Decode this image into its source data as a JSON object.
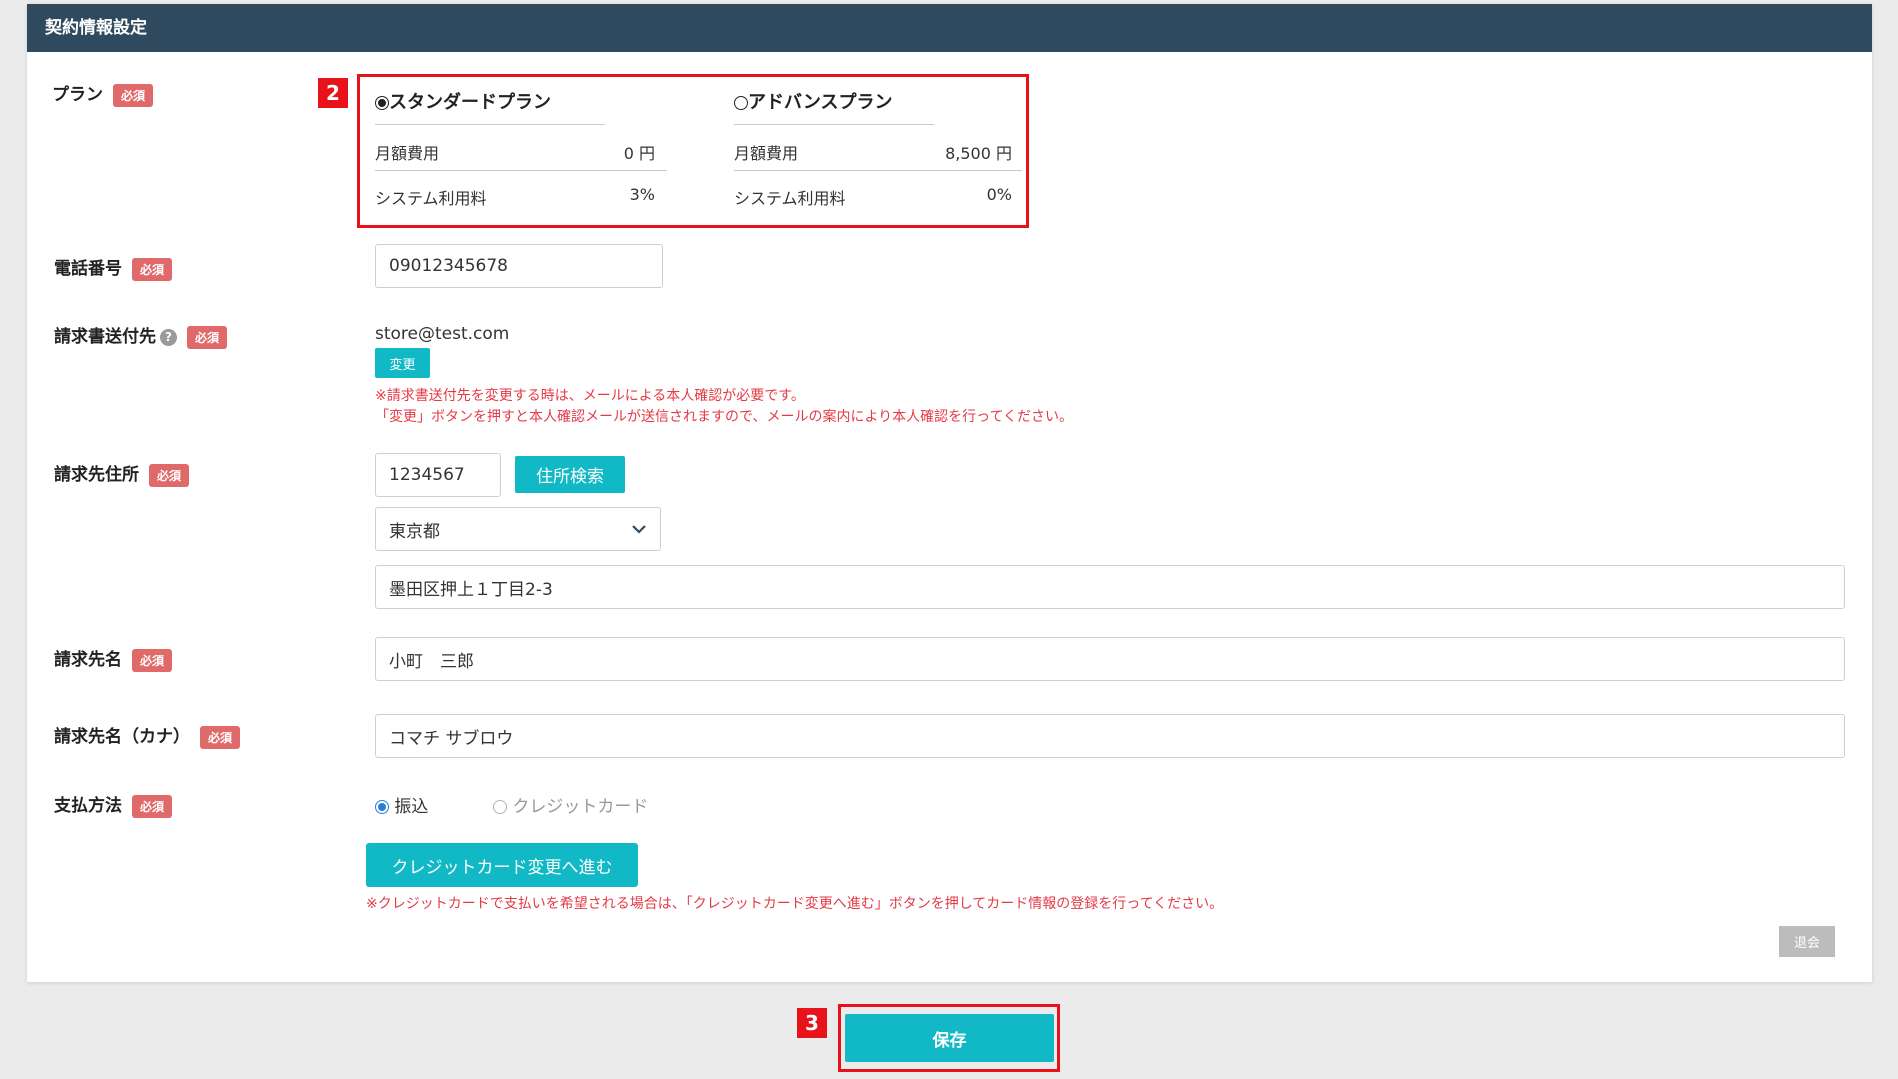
{
  "header": {
    "title": "契約情報設定"
  },
  "required_badge": "必須",
  "markers": {
    "plan": "2",
    "save": "3"
  },
  "plan": {
    "label": "プラン",
    "options": [
      {
        "name": "スタンダードプラン",
        "selected": true,
        "rows": [
          {
            "key": "月額費用",
            "value": "0 円"
          },
          {
            "key": "システム利用料",
            "value": "3%"
          }
        ]
      },
      {
        "name": "アドバンスプラン",
        "selected": false,
        "rows": [
          {
            "key": "月額費用",
            "value": "8,500 円"
          },
          {
            "key": "システム利用料",
            "value": "0%"
          }
        ]
      }
    ]
  },
  "phone": {
    "label": "電話番号",
    "value": "09012345678"
  },
  "invoice_email": {
    "label": "請求書送付先",
    "help_icon": "question-icon",
    "value": "store@test.com",
    "change_button": "変更",
    "note_line1": "※請求書送付先を変更する時は、メールによる本人確認が必要です。",
    "note_line2": "「変更」ボタンを押すと本人確認メールが送信されますので、メールの案内により本人確認を行ってください。"
  },
  "address": {
    "label": "請求先住所",
    "zip": "1234567",
    "search_button": "住所検索",
    "prefecture": "東京都",
    "street": "墨田区押上１丁目2-3"
  },
  "billing_name": {
    "label": "請求先名",
    "value": "小町　三郎"
  },
  "billing_kana": {
    "label": "請求先名（カナ）",
    "value": "コマチ サブロウ"
  },
  "payment": {
    "label": "支払方法",
    "options": [
      {
        "label": "振込",
        "selected": true
      },
      {
        "label": "クレジットカード",
        "selected": false
      }
    ],
    "credit_button": "クレジットカード変更へ進む",
    "note": "※クレジットカードで支払いを希望される場合は、「クレジットカード変更へ進む」ボタンを押してカード情報の登録を行ってください。"
  },
  "withdraw_button": "退会",
  "save_button": "保存"
}
